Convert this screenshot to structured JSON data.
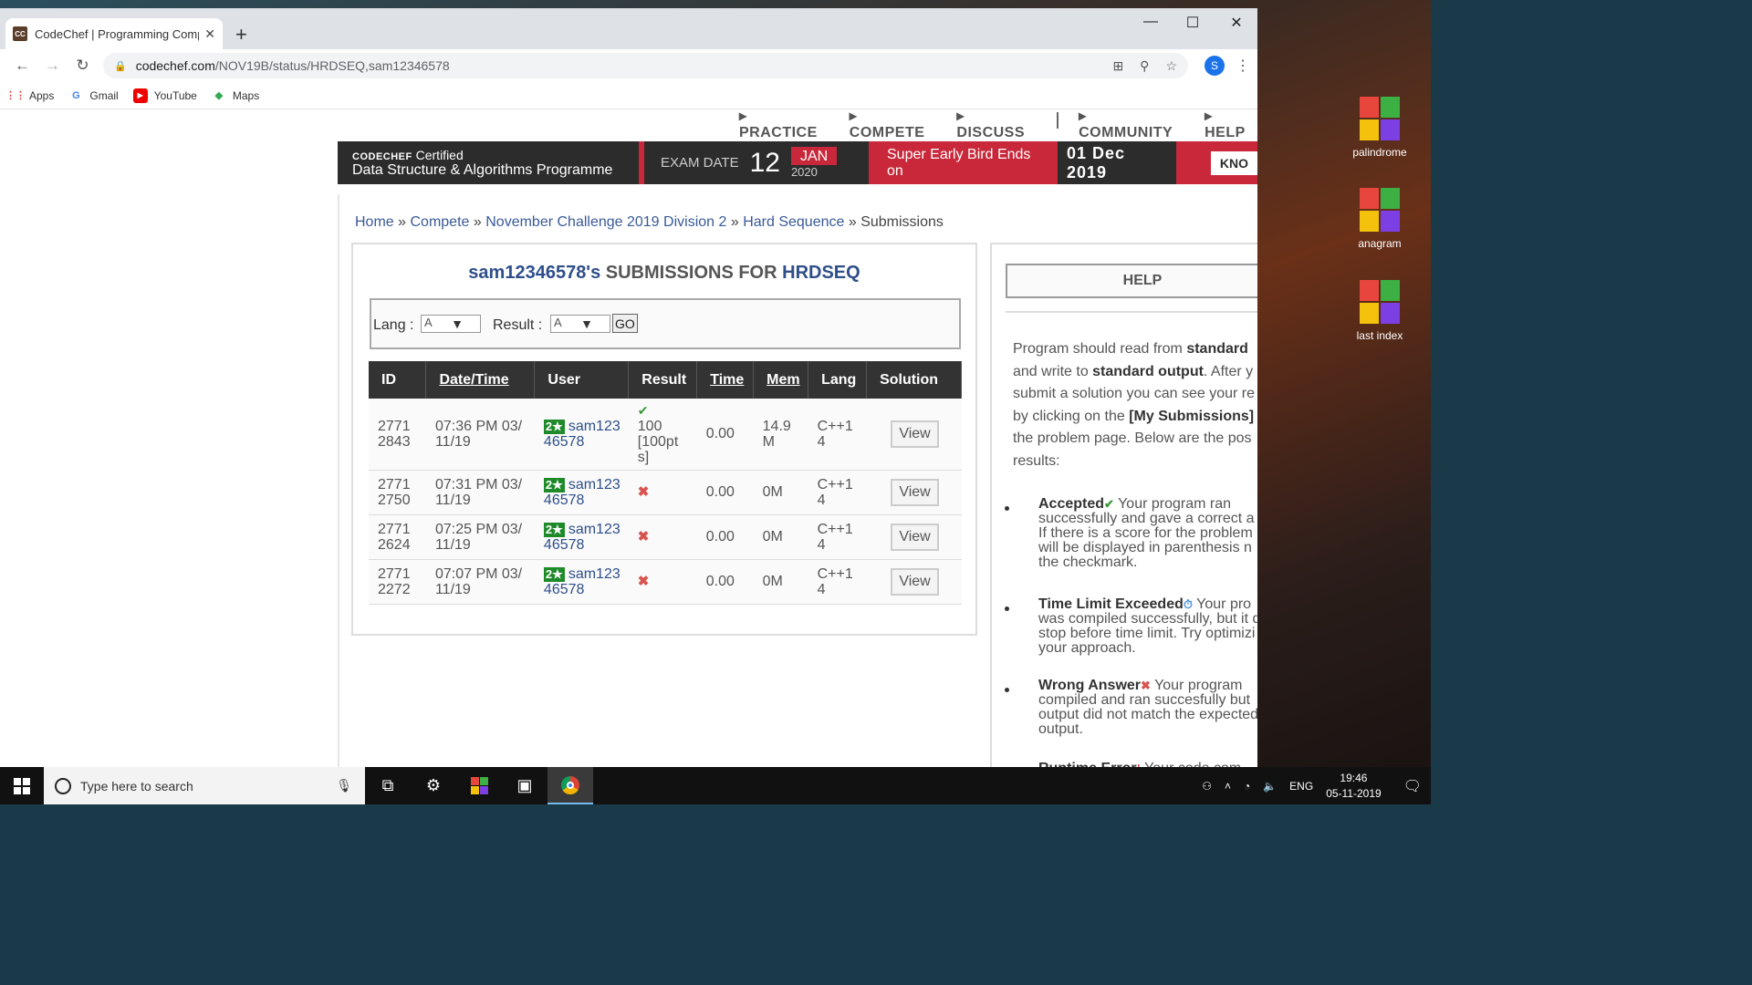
{
  "desktop": {
    "icons": [
      {
        "label": "palindrome"
      },
      {
        "label": "anagram"
      },
      {
        "label": "last index"
      }
    ]
  },
  "browser": {
    "tab": {
      "title": "CodeChef | Programming Compe",
      "favicon": "CC"
    },
    "url": {
      "host": "codechef.com",
      "path": "/NOV19B/status/HRDSEQ,sam12346578"
    },
    "profile_initial": "S",
    "bookmarks": [
      {
        "label": "Apps",
        "icon": "apps-grid-icon"
      },
      {
        "label": "Gmail",
        "icon": "google-icon"
      },
      {
        "label": "YouTube",
        "icon": "youtube-icon"
      },
      {
        "label": "Maps",
        "icon": "maps-icon"
      }
    ]
  },
  "site": {
    "nav": [
      "PRACTICE",
      "COMPETE",
      "DISCUSS",
      "COMMUNITY",
      "HELP"
    ],
    "banner": {
      "brand": "CODECHEF",
      "certified": "Certified",
      "programme": "Data Structure & Algorithms Programme",
      "exam_label": "EXAM DATE",
      "exam_day": "12",
      "exam_month": "JAN",
      "exam_year": "2020",
      "early_bird": "Super Early Bird Ends on",
      "early_date": "01 Dec 2019",
      "cta": "KNO"
    },
    "breadcrumb": {
      "links": [
        "Home",
        "Compete",
        "November Challenge 2019 Division 2",
        "Hard Sequence"
      ],
      "current": "Submissions",
      "separator": "»"
    }
  },
  "submissions": {
    "user": "sam12346578's",
    "title_mid": "SUBMISSIONS FOR",
    "problem": "HRDSEQ",
    "filter": {
      "lang_label": "Lang :",
      "lang_value": "A",
      "result_label": "Result :",
      "result_value": "A",
      "go": "GO"
    },
    "columns": [
      "ID",
      "Date/Time",
      "User",
      "Result",
      "Time",
      "Mem",
      "Lang",
      "Solution"
    ],
    "rows": [
      {
        "id": "2771\n2843",
        "datetime": "07:36 PM 03/\n11/19",
        "stars": "2★",
        "user": "sam123\n46578",
        "result": "100\n[100pt\ns]",
        "status": "accepted",
        "time": "0.00",
        "mem": "14.9\nM",
        "lang": "C++1\n4",
        "view": "View"
      },
      {
        "id": "2771\n2750",
        "datetime": "07:31 PM 03/\n11/19",
        "stars": "2★",
        "user": "sam123\n46578",
        "result": "",
        "status": "wrong",
        "time": "0.00",
        "mem": "0M",
        "lang": "C++1\n4",
        "view": "View"
      },
      {
        "id": "2771\n2624",
        "datetime": "07:25 PM 03/\n11/19",
        "stars": "2★",
        "user": "sam123\n46578",
        "result": "",
        "status": "wrong",
        "time": "0.00",
        "mem": "0M",
        "lang": "C++1\n4",
        "view": "View"
      },
      {
        "id": "2771\n2272",
        "datetime": "07:07 PM 03/\n11/19",
        "stars": "2★",
        "user": "sam123\n46578",
        "result": "",
        "status": "wrong",
        "time": "0.00",
        "mem": "0M",
        "lang": "C++1\n4",
        "view": "View"
      }
    ]
  },
  "help": {
    "heading": "HELP",
    "intro": [
      [
        "Program should read from ",
        "standard"
      ],
      [
        "and write to ",
        "standard output",
        ". After y"
      ],
      [
        "submit a solution you can see your re"
      ],
      [
        "by clicking on the ",
        "[My Submissions]"
      ],
      [
        "the problem page. Below are the pos"
      ],
      [
        "results:"
      ]
    ],
    "items": [
      {
        "title": "Accepted",
        "icon": "check-icon",
        "lines": [
          "Your program ran",
          "successfully and gave a correct a",
          "If there is a score for the problem",
          "will be displayed in parenthesis n",
          "the checkmark."
        ]
      },
      {
        "title": "Time Limit Exceeded",
        "icon": "clock-icon",
        "lines": [
          "Your pro",
          "was compiled successfully, but it d",
          "stop before time limit. Try optimizi",
          "your approach."
        ]
      },
      {
        "title": "Wrong Answer",
        "icon": "cross-icon",
        "lines": [
          "Your program",
          "compiled and ran succesfully but",
          "output did not match the expected",
          "output."
        ]
      },
      {
        "title": "Runtime Error",
        "icon": "error-icon",
        "lines": [
          "Your code com"
        ]
      }
    ]
  },
  "taskbar": {
    "search_placeholder": "Type here to search",
    "language": "ENG",
    "time": "19:46",
    "date": "05-11-2019"
  },
  "colors": {
    "accent_red": "#c8283a",
    "link_blue": "#2e4f8a",
    "star_green": "#1f8a2a"
  }
}
